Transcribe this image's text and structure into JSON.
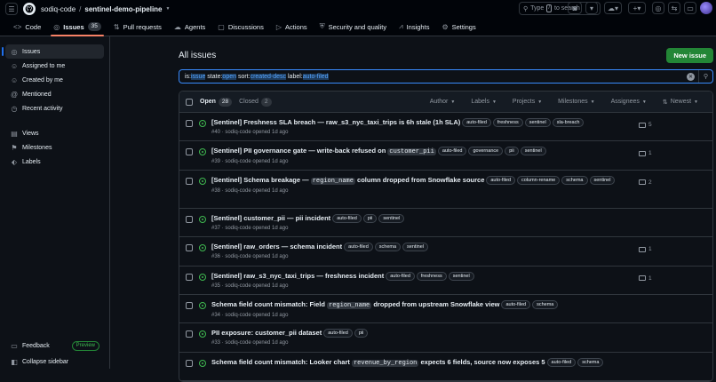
{
  "header": {
    "owner": "sodiq-code",
    "separator": "/",
    "repo": "sentinel-demo-pipeline",
    "search_prefix": "Type",
    "search_key": "/",
    "search_suffix": "to search"
  },
  "nav": {
    "items": [
      {
        "label": "Code",
        "icon": "code-icon"
      },
      {
        "label": "Issues",
        "icon": "issue-icon",
        "count": "35"
      },
      {
        "label": "Pull requests",
        "icon": "pull-request-icon"
      },
      {
        "label": "Agents",
        "icon": "agents-icon"
      },
      {
        "label": "Discussions",
        "icon": "discussions-icon"
      },
      {
        "label": "Actions",
        "icon": "actions-icon"
      },
      {
        "label": "Security and quality",
        "icon": "shield-icon"
      },
      {
        "label": "Insights",
        "icon": "graph-icon"
      },
      {
        "label": "Settings",
        "icon": "gear-icon"
      }
    ]
  },
  "sidebar": {
    "items": [
      {
        "label": "Issues"
      },
      {
        "label": "Assigned to me"
      },
      {
        "label": "Created by me"
      },
      {
        "label": "Mentioned"
      },
      {
        "label": "Recent activity"
      }
    ],
    "secondary": [
      {
        "label": "Views"
      },
      {
        "label": "Milestones"
      },
      {
        "label": "Labels"
      }
    ],
    "feedback": "Feedback",
    "preview": "Preview",
    "collapse": "Collapse sidebar"
  },
  "main": {
    "title": "All issues",
    "new_issue": "New issue",
    "filter": {
      "is_key": "is:",
      "is_val": "issue",
      "state_key": "state:",
      "state_val": "open",
      "sort_key": "sort:",
      "sort_val": "created-desc",
      "label_key": "label:",
      "label_val": "auto-filed"
    },
    "open_label": "Open",
    "open_count": "28",
    "closed_label": "Closed",
    "closed_count": "2",
    "filters": [
      "Author",
      "Labels",
      "Projects",
      "Milestones",
      "Assignees",
      "Newest"
    ]
  },
  "issues": [
    {
      "title": "[Sentinel] Freshness SLA breach — raw_s3_nyc_taxi_trips is 6h stale (1h SLA)",
      "labels": [
        "auto-filed",
        "freshness",
        "sentinel",
        "sla-breach"
      ],
      "meta": "#40 · sodiq-code opened 1d ago",
      "comments": "5"
    },
    {
      "title_pre": "[Sentinel] PII governance gate — write-back refused on ",
      "code": "customer_pii",
      "title_post": "",
      "labels": [
        "auto-filed",
        "governance",
        "pii",
        "sentinel"
      ],
      "meta": "#39 · sodiq-code opened 1d ago",
      "comments": "1"
    },
    {
      "title_pre": "[Sentinel] Schema breakage — ",
      "code": "region_name",
      "title_post": " column dropped from Snowflake source",
      "labels": [
        "auto-filed",
        "column-rename",
        "schema",
        "sentinel"
      ],
      "meta": "#38 · sodiq-code opened 1d ago",
      "comments": "2"
    },
    {
      "title": "[Sentinel] customer_pii — pii incident",
      "labels": [
        "auto-filed",
        "pii",
        "sentinel"
      ],
      "meta": "#37 · sodiq-code opened 1d ago",
      "comments": ""
    },
    {
      "title": "[Sentinel] raw_orders — schema incident",
      "labels": [
        "auto-filed",
        "schema",
        "sentinel"
      ],
      "meta": "#36 · sodiq-code opened 1d ago",
      "comments": "1"
    },
    {
      "title": "[Sentinel] raw_s3_nyc_taxi_trips — freshness incident",
      "labels": [
        "auto-filed",
        "freshness",
        "sentinel"
      ],
      "meta": "#35 · sodiq-code opened 1d ago",
      "comments": "1"
    },
    {
      "title_pre": "Schema field count mismatch: Field ",
      "code": "region_name",
      "title_post": " dropped from upstream Snowflake view",
      "labels": [
        "auto-filed",
        "schema"
      ],
      "meta": "#34 · sodiq-code opened 1d ago",
      "comments": ""
    },
    {
      "title": "PII exposure: customer_pii dataset",
      "labels": [
        "auto-filed",
        "pii"
      ],
      "meta": "#33 · sodiq-code opened 1d ago",
      "comments": ""
    },
    {
      "title_pre": "Schema field count mismatch: Looker chart ",
      "code": "revenue_by_region",
      "title_post": " expects 6 fields, source now exposes 5",
      "labels": [
        "auto-filed",
        "schema"
      ],
      "meta": "",
      "comments": ""
    }
  ]
}
